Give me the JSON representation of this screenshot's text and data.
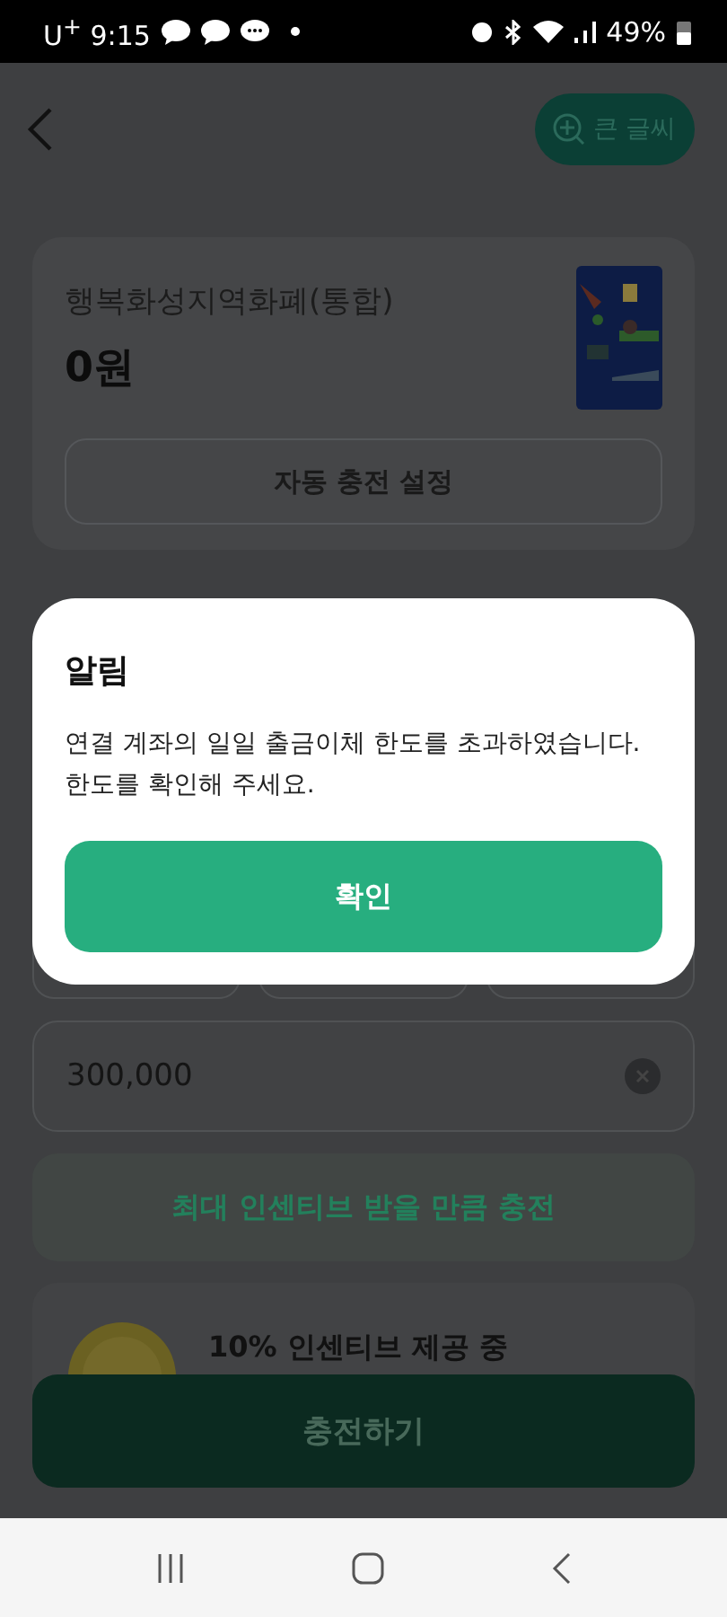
{
  "status_bar": {
    "carrier_time": "U$^{+}$ 9:15",
    "battery": "49%"
  },
  "app_bar": {
    "large_text_button": "큰 글씨"
  },
  "wallet_card": {
    "title": "행복화성지역화폐(통합)",
    "balance": "0원",
    "auto_charge_button": "자동 충전 설정"
  },
  "amount_field": {
    "value": "300,000"
  },
  "max_incentive_button": "최대 인센티브 받을 만큼 충전",
  "incentive_banner": {
    "title": "10% 인센티브 제공 중"
  },
  "charge_button": "충전하기",
  "dialog": {
    "title": "알림",
    "message": "연결 계좌의 일일 출금이체 한도를 초과하였습니다.\n한도를 확인해 주세요.",
    "confirm_button": "확인"
  }
}
